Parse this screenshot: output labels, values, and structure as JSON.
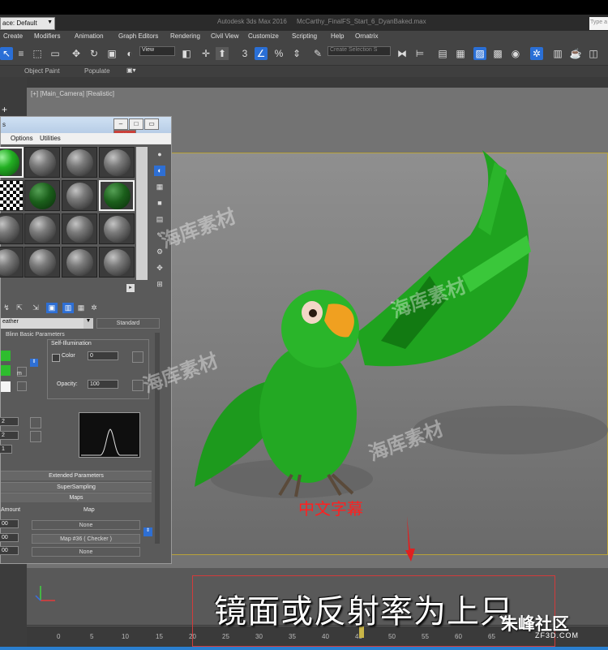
{
  "window": {
    "workspace": "ace: Default",
    "title": "Autodesk 3ds Max 2016",
    "file": "McCarthy_FinalFS_Start_6_DyanBaked.max",
    "search_placeholder": "Type a"
  },
  "menus": [
    "Create",
    "Modifiers",
    "Animation",
    "Graph Editors",
    "Rendering",
    "Civil View",
    "Customize",
    "Scripting",
    "Help",
    "Ornatrix"
  ],
  "toolbar": {
    "view_dropdown": "View",
    "selection_set_placeholder": "Create Selection S",
    "snap_label": "3",
    "percent_label": "%",
    "icons": [
      "select-icon",
      "select-region-icon",
      "move-icon",
      "rotate-icon",
      "scale-icon",
      "link-icon",
      "pivot-icon",
      "snap-icon",
      "angle-snap-icon",
      "percent-snap-icon",
      "spinner-snap-icon",
      "named-selection-icon",
      "mirror-icon",
      "align-icon",
      "layer-icon",
      "ribbon-icon",
      "curve-editor-icon",
      "schematic-icon",
      "material-editor-icon",
      "render-setup-icon",
      "render-frame-icon",
      "render-icon"
    ]
  },
  "ribbon": {
    "object_paint": "Object Paint",
    "populate": "Populate"
  },
  "viewport": {
    "label": "[+] [Main_Camera] [Realistic]"
  },
  "material_editor": {
    "title": "s",
    "menus": [
      "Options",
      "Utilities"
    ],
    "material_name": "eather",
    "material_type": "Standard",
    "rollouts": {
      "basic": "Blinn Basic Parameters",
      "extended": "Extended Parameters",
      "supersampling": "SuperSampling",
      "maps": "Maps"
    },
    "self_illumination": "Self-Illumination",
    "color_label": "Color",
    "color_value": "0",
    "opacity_label": "Opacity:",
    "opacity_value": "100",
    "m_label": "m",
    "spec_values": [
      "2",
      "2",
      "1"
    ],
    "maps_headers": {
      "amount": "Amount",
      "map": "Map"
    },
    "map_rows": [
      {
        "amount": "00",
        "map": "None"
      },
      {
        "amount": "00",
        "map": "Map #36  ( Checker )"
      },
      {
        "amount": "00",
        "map": "None"
      }
    ]
  },
  "timeline": {
    "ticks": [
      "0",
      "5",
      "10",
      "15",
      "20",
      "25",
      "30",
      "35",
      "40",
      "45",
      "50",
      "55",
      "60",
      "65"
    ],
    "current_frame": 45
  },
  "overlays": {
    "subtitle_main": "镜面或反射率为上只",
    "subtitle_cn": "中文字幕",
    "watermark": "海库素材",
    "logo": "朱峰社区",
    "logo_sub": "ZF3D.COM"
  }
}
